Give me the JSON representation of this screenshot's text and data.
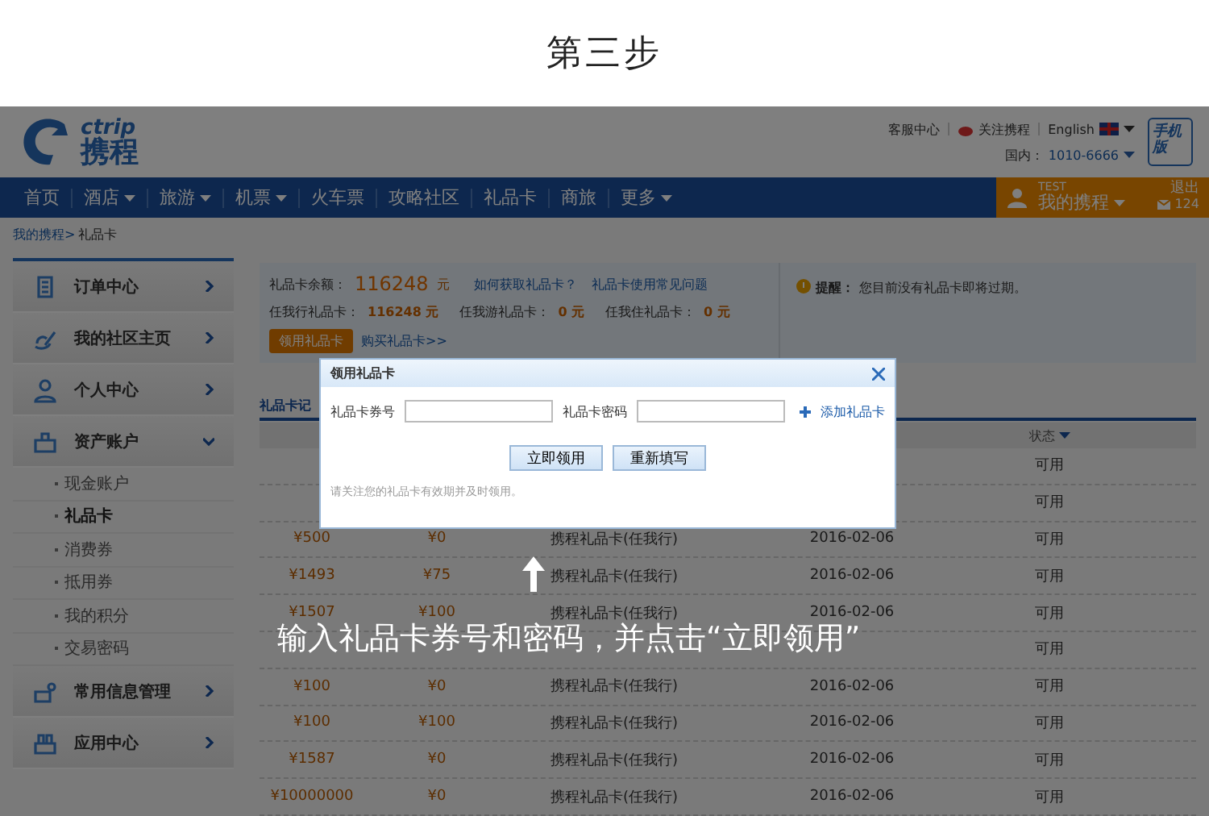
{
  "page_title": "第三步",
  "logo": {
    "latin": "ctrip",
    "chinese": "携程"
  },
  "header": {
    "links": [
      "客服中心",
      "关注携程",
      "English"
    ],
    "hotline_label": "国内：",
    "hotline": "1010-6666",
    "mobile": "手机版"
  },
  "nav": [
    {
      "label": "首页",
      "dropdown": false
    },
    {
      "label": "酒店",
      "dropdown": true
    },
    {
      "label": "旅游",
      "dropdown": true
    },
    {
      "label": "机票",
      "dropdown": true
    },
    {
      "label": "火车票",
      "dropdown": false
    },
    {
      "label": "攻略社区",
      "dropdown": false
    },
    {
      "label": "礼品卡",
      "dropdown": false
    },
    {
      "label": "商旅",
      "dropdown": false
    },
    {
      "label": "更多",
      "dropdown": true
    }
  ],
  "user_box": {
    "name": "TEST",
    "menu": "我的携程",
    "logout": "退出",
    "messages": "124"
  },
  "breadcrumb": {
    "link": "我的携程>",
    "current": "礼品卡"
  },
  "sidebar": [
    {
      "label": "订单中心",
      "expanded": false
    },
    {
      "label": "我的社区主页",
      "expanded": false
    },
    {
      "label": "个人中心",
      "expanded": false
    },
    {
      "label": "资产账户",
      "expanded": true,
      "children": [
        {
          "label": "现金账户",
          "selected": false
        },
        {
          "label": "礼品卡",
          "selected": true
        },
        {
          "label": "消费券",
          "selected": false
        },
        {
          "label": "抵用券",
          "selected": false
        },
        {
          "label": "我的积分",
          "selected": false
        },
        {
          "label": "交易密码",
          "selected": false
        }
      ]
    },
    {
      "label": "常用信息管理",
      "expanded": false
    },
    {
      "label": "应用中心",
      "expanded": false
    }
  ],
  "summary": {
    "balance_label": "礼品卡余额：",
    "balance": "116248",
    "balance_unit": "元",
    "links": [
      "如何获取礼品卡？",
      "礼品卡使用常见问题"
    ],
    "subtotals": [
      {
        "label": "任我行礼品卡：",
        "value": "116248 元"
      },
      {
        "label": "任我游礼品卡：",
        "value": "0 元"
      },
      {
        "label": "任我住礼品卡：",
        "value": "0 元"
      }
    ],
    "claim_button": "领用礼品卡",
    "buy_link": "购买礼品卡>>",
    "notice_label": "提醒：",
    "notice": "您目前没有礼品卡即将过期。"
  },
  "table": {
    "title": "礼品卡记",
    "status_header": "状态",
    "rows": [
      {
        "status": "可用"
      },
      {
        "status": "可用"
      },
      {
        "amount": "¥500",
        "balance": "¥0",
        "type": "携程礼品卡(任我行)",
        "date": "2016-02-06",
        "status": "可用"
      },
      {
        "amount": "¥1493",
        "balance": "¥75",
        "type": "携程礼品卡(任我行)",
        "date": "2016-02-06",
        "status": "可用"
      },
      {
        "amount": "¥1507",
        "balance": "¥100",
        "type": "携程礼品卡(任我行)",
        "date": "2016-02-06",
        "status": "可用"
      },
      {
        "status": "可用"
      },
      {
        "amount": "¥100",
        "balance": "¥0",
        "type": "携程礼品卡(任我行)",
        "date": "2016-02-06",
        "status": "可用"
      },
      {
        "amount": "¥100",
        "balance": "¥100",
        "type": "携程礼品卡(任我行)",
        "date": "2016-02-06",
        "status": "可用"
      },
      {
        "amount": "¥1587",
        "balance": "¥0",
        "type": "携程礼品卡(任我行)",
        "date": "2016-02-06",
        "status": "可用"
      },
      {
        "amount": "¥10000000",
        "balance": "¥0",
        "type": "携程礼品卡(任我行)",
        "date": "2016-02-06",
        "status": "可用"
      }
    ]
  },
  "dialog": {
    "title": "领用礼品卡",
    "fields": [
      {
        "label": "礼品卡券号"
      },
      {
        "label": "礼品卡密码"
      }
    ],
    "add_link": "添加礼品卡",
    "buttons": [
      "立即领用",
      "重新填写"
    ],
    "note": "请关注您的礼品卡有效期并及时领用。"
  },
  "caption": "输入礼品卡券号和密码，并点击“立即领用”"
}
